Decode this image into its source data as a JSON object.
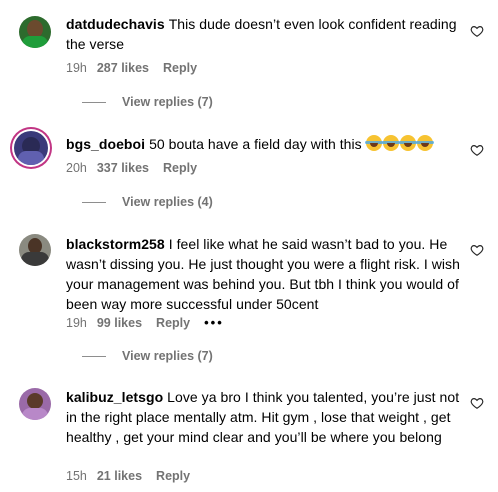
{
  "comments": [
    {
      "username": "datdudechavis",
      "text": "This dude doesn’t even look confident reading the verse",
      "time": "19h",
      "likes": "287 likes",
      "reply": "Reply",
      "view_replies": "View replies (7)"
    },
    {
      "username": "bgs_doeboi",
      "text": "50 bouta have a field day with this",
      "time": "20h",
      "likes": "337 likes",
      "reply": "Reply",
      "view_replies": "View replies (4)"
    },
    {
      "username": "blackstorm258",
      "text": "I feel like what he said wasn’t bad to you. He wasn’t dissing you. He just thought you were a flight risk. I wish your management was behind you. But tbh I think you would of been way more successful under 50cent",
      "time": "19h",
      "likes": "99 likes",
      "reply": "Reply",
      "more": "•••",
      "view_replies": "View replies (7)"
    },
    {
      "username": "kalibuz_letsgo",
      "text": "Love ya bro I think you talented, you’re just not in the right place mentally atm. Hit gym , lose that weight , get healthy , get your mind clear and you’ll be where you belong",
      "time": "15h",
      "likes": "21 likes",
      "reply": "Reply"
    }
  ],
  "icons": {
    "like": "heart-outline-icon",
    "emoji": "face-with-tears-of-joy-icon"
  },
  "colors": {
    "meta": "#737373",
    "story_ring": "#c13584"
  }
}
